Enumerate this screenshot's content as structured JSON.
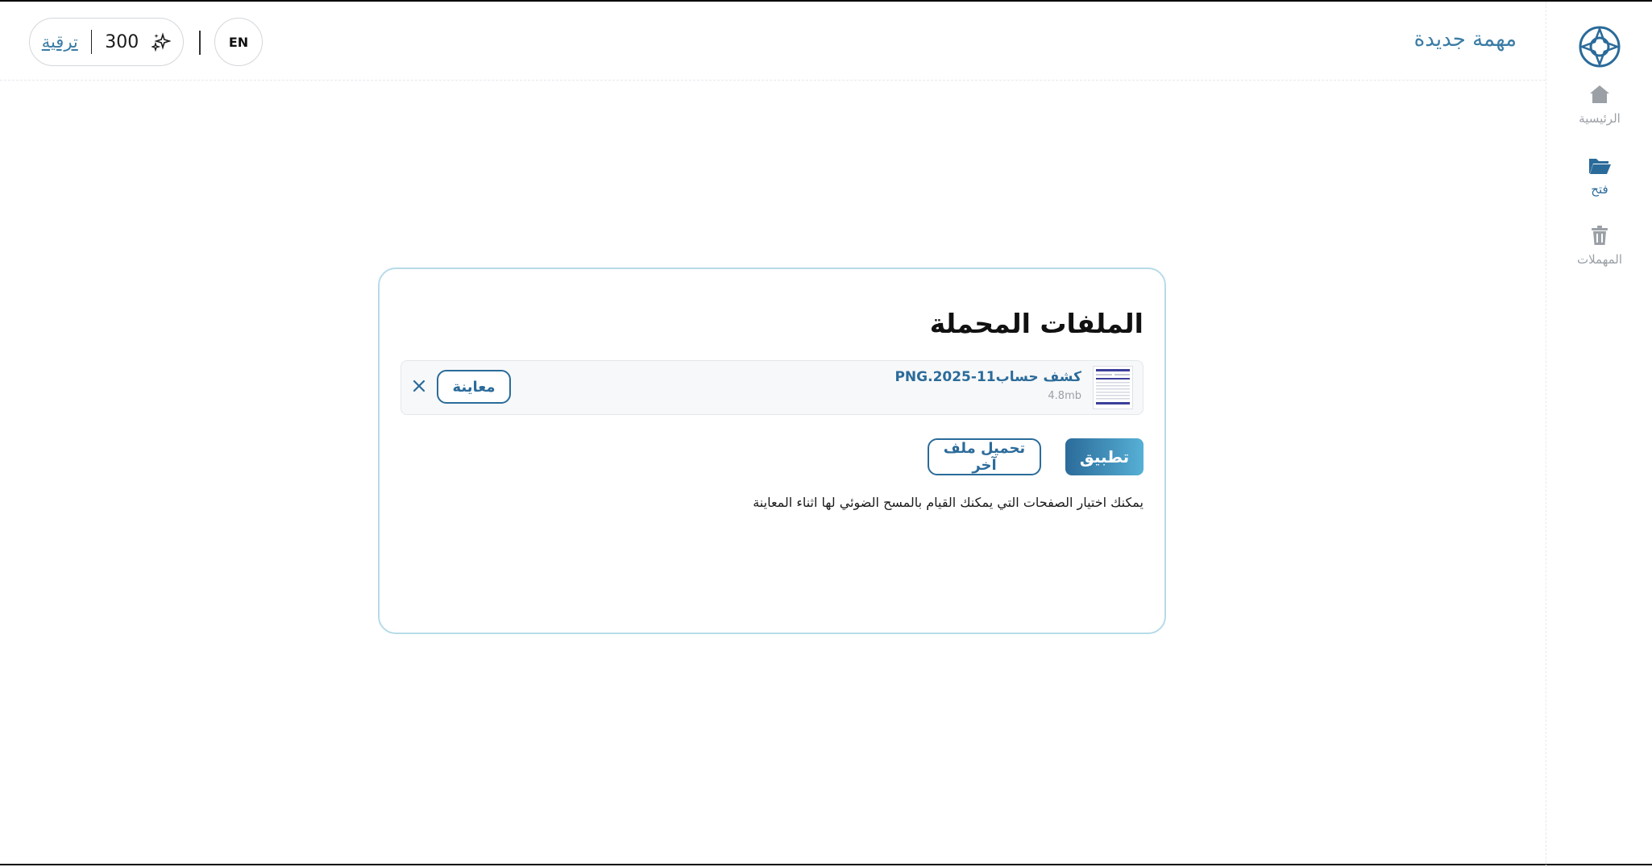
{
  "sidebar": {
    "items": [
      {
        "label": "الرئيسية",
        "icon": "home-icon"
      },
      {
        "label": "فتح",
        "icon": "folder-open-icon"
      },
      {
        "label": "المهملات",
        "icon": "trash-icon"
      }
    ]
  },
  "header": {
    "title": "مهمة جديدة",
    "upgrade_label": "ترقية",
    "credits": "300",
    "language_label": "EN"
  },
  "card": {
    "title": "الملفات المحملة",
    "file": {
      "name": "كشف حساب11-PNG.2025",
      "size": "4.8mb",
      "preview_label": "معاينة"
    },
    "apply_label": "تطبيق",
    "upload_another_label": "تحميل ملف آخر",
    "hint": "يمكنك اختيار الصفحات التي يمكنك القيام بالمسح الضوئي لها اثناء المعاينة"
  },
  "colors": {
    "accent": "#2b6b9a",
    "accent_light": "#56b0d6",
    "card_border": "#b7dbe8",
    "muted": "#9aa0a6"
  }
}
